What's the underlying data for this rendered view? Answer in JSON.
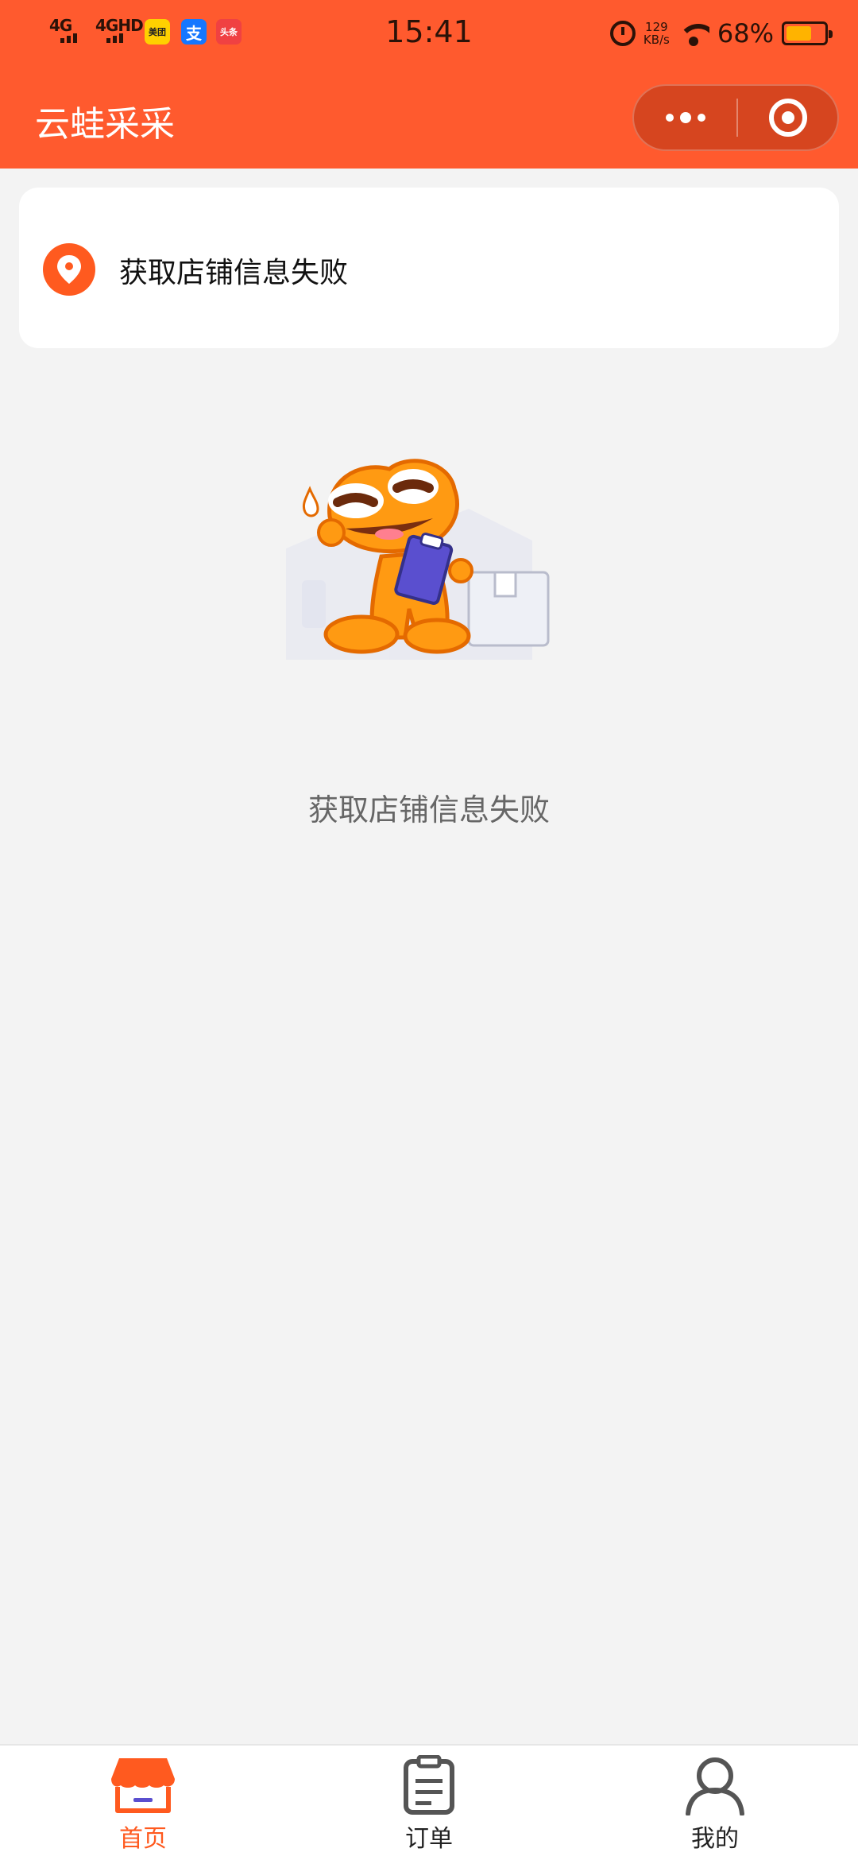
{
  "status_bar": {
    "signal_1": "4G",
    "signal_2": "4GHD",
    "app_icons": [
      {
        "name": "meituan-icon",
        "label": "美团",
        "color": "#ffd100"
      },
      {
        "name": "alipay-icon",
        "label": "支",
        "color": "#1677ff"
      },
      {
        "name": "toutiao-icon",
        "label": "头条",
        "color": "#f04142"
      }
    ],
    "time": "15:41",
    "speed_value": "129",
    "speed_unit": "KB/s",
    "battery_percent": "68%",
    "battery_level": 0.68
  },
  "navbar": {
    "title": "云蛙采采",
    "more_icon": "more-dots-icon",
    "close_icon": "target-close-icon"
  },
  "store_card": {
    "icon": "location-pin-icon",
    "text": "获取店铺信息失败"
  },
  "empty_state": {
    "illustration": "frog-mascot-clipboard",
    "message": "获取店铺信息失败"
  },
  "tabbar": {
    "items": [
      {
        "label": "首页",
        "icon": "storefront-icon",
        "active": true
      },
      {
        "label": "订单",
        "icon": "clipboard-icon",
        "active": false
      },
      {
        "label": "我的",
        "icon": "user-icon",
        "active": false
      }
    ]
  },
  "colors": {
    "primary": "#ff5a2e",
    "background": "#f3f3f3",
    "active_tab": "#ff5a1f",
    "mascot": "#ff9a12"
  }
}
